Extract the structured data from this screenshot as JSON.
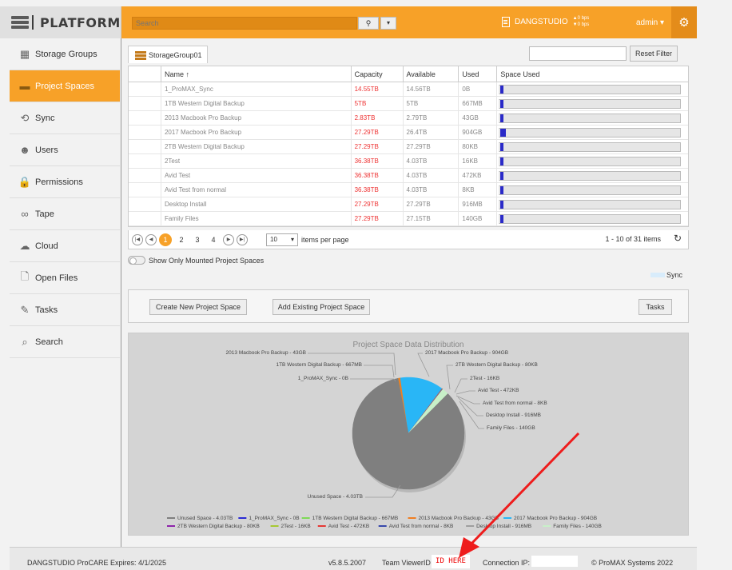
{
  "header": {
    "logo_text": "PLATFORM",
    "search_placeholder": "Search",
    "search_btn_icon": "search-icon",
    "server_name": "DANGSTUDIO",
    "bps_up": "▲0 bps",
    "bps_down": "▼0 bps",
    "user": "admin ▾",
    "accent": "#f7a128"
  },
  "sidebar": {
    "items": [
      {
        "label": "Storage Groups",
        "icon": "storage-groups-icon",
        "glyph": "▦"
      },
      {
        "label": "Project Spaces",
        "icon": "folder-icon",
        "glyph": "▬"
      },
      {
        "label": "Sync",
        "icon": "sync-icon",
        "glyph": "⟲"
      },
      {
        "label": "Users",
        "icon": "users-icon",
        "glyph": "☻"
      },
      {
        "label": "Permissions",
        "icon": "lock-icon",
        "glyph": "🔒"
      },
      {
        "label": "Tape",
        "icon": "tape-icon",
        "glyph": "∞"
      },
      {
        "label": "Cloud",
        "icon": "cloud-icon",
        "glyph": "☁"
      },
      {
        "label": "Open Files",
        "icon": "open-files-icon",
        "glyph": "🗋"
      },
      {
        "label": "Tasks",
        "icon": "tasks-icon",
        "glyph": "✎"
      },
      {
        "label": "Search",
        "icon": "search-icon",
        "glyph": "⌕"
      }
    ],
    "active_index": 1
  },
  "main": {
    "tab_label": "StorageGroup01",
    "reset_filter": "Reset Filter",
    "columns": [
      "Name ↑",
      "Capacity",
      "Available",
      "Used",
      "Space Used"
    ],
    "rows": [
      {
        "name": "1_ProMAX_Sync",
        "capacity": "14.55TB",
        "available": "14.56TB",
        "used": "0B",
        "pct": 0
      },
      {
        "name": "1TB Western Digital Backup",
        "capacity": "5TB",
        "available": "5TB",
        "used": "667MB",
        "pct": 0
      },
      {
        "name": "2013 Macbook Pro Backup",
        "capacity": "2.83TB",
        "available": "2.79TB",
        "used": "43GB",
        "pct": 0.015
      },
      {
        "name": "2017 Macbook Pro Backup",
        "capacity": "27.29TB",
        "available": "26.4TB",
        "used": "904GB",
        "pct": 0.033
      },
      {
        "name": "2TB Western Digital Backup",
        "capacity": "27.29TB",
        "available": "27.29TB",
        "used": "80KB",
        "pct": 0
      },
      {
        "name": "2Test",
        "capacity": "36.38TB",
        "available": "4.03TB",
        "used": "16KB",
        "pct": 0
      },
      {
        "name": "Avid Test",
        "capacity": "36.38TB",
        "available": "4.03TB",
        "used": "472KB",
        "pct": 0
      },
      {
        "name": "Avid Test from normal",
        "capacity": "36.38TB",
        "available": "4.03TB",
        "used": "8KB",
        "pct": 0
      },
      {
        "name": "Desktop Install",
        "capacity": "27.29TB",
        "available": "27.29TB",
        "used": "916MB",
        "pct": 0
      },
      {
        "name": "Family Files",
        "capacity": "27.29TB",
        "available": "27.15TB",
        "used": "140GB",
        "pct": 0.005
      }
    ],
    "pager": {
      "pages": [
        "1",
        "2",
        "3",
        "4"
      ],
      "current": "1",
      "page_size": "10",
      "per_page_label": "items per page",
      "info": "1 - 10 of 31 items"
    },
    "toggle_label": "Show Only Mounted Project Spaces",
    "sync_legend": "Sync",
    "buttons": {
      "create": "Create New Project Space",
      "add": "Add Existing Project Space",
      "tasks": "Tasks"
    }
  },
  "chart_data": {
    "type": "pie",
    "title": "Project Space Data Distribution",
    "slices": [
      {
        "label": "Unused Space - 4.03TB",
        "color": "#7f7f7f",
        "value": 0.85
      },
      {
        "label": "1_ProMAX_Sync - 0B",
        "color": "#2b2bd4",
        "value": 0.0005
      },
      {
        "label": "1TB Western Digital Backup - 667MB",
        "color": "#7ed957",
        "value": 0.0005
      },
      {
        "label": "2013 Macbook Pro Backup - 43GB",
        "color": "#f07e22",
        "value": 0.006
      },
      {
        "label": "2017 Macbook Pro Backup - 904GB",
        "color": "#29b6f6",
        "value": 0.126
      },
      {
        "label": "2TB Western Digital Backup - 80KB",
        "color": "#8e24aa",
        "value": 0.0005
      },
      {
        "label": "2Test - 16KB",
        "color": "#a6c832",
        "value": 0.0005
      },
      {
        "label": "Avid Test - 472KB",
        "color": "#e53935",
        "value": 0.0005
      },
      {
        "label": "Avid Test from normal - 8KB",
        "color": "#3949ab",
        "value": 0.0005
      },
      {
        "label": "Desktop Install - 916MB",
        "color": "#9e9e9e",
        "value": 0.0005
      },
      {
        "label": "Family Files - 140GB",
        "color": "#c8f0c8",
        "value": 0.019
      }
    ]
  },
  "footer": {
    "license": "DANGSTUDIO ProCARE Expires: 4/1/2025",
    "version": "v5.8.5.2007",
    "viewer_label": "Team ViewerID",
    "viewer_id": "ID HERE",
    "conn_label": "Connection IP:",
    "copyright": "© ProMAX Systems 2022"
  }
}
